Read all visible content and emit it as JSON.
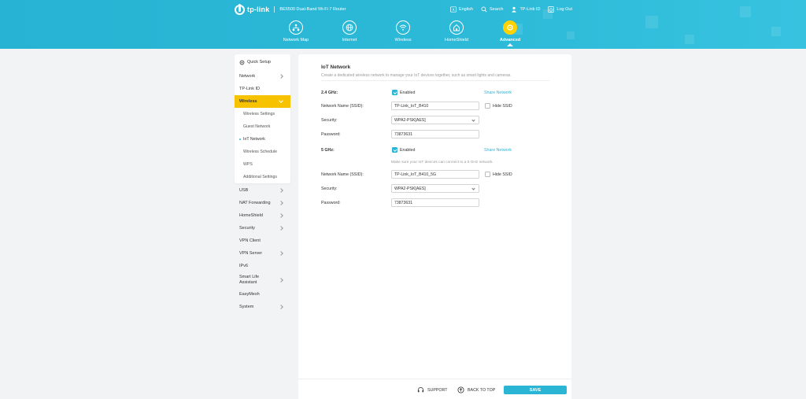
{
  "header": {
    "brand": "tp-link",
    "product": "BE6500 Dual-Band Wi-Fi 7 Router",
    "links": [
      {
        "label": "English",
        "icon": "globe-icon"
      },
      {
        "label": "Search",
        "icon": "search-icon"
      },
      {
        "label": "TP-Link ID",
        "icon": "person-icon"
      },
      {
        "label": "Log Out",
        "icon": "logout-icon"
      }
    ],
    "nav": [
      {
        "label": "Network Map",
        "icon": "network-map-icon"
      },
      {
        "label": "Internet",
        "icon": "globe-icon"
      },
      {
        "label": "Wireless",
        "icon": "wifi-icon"
      },
      {
        "label": "HomeShield",
        "icon": "home-shield-icon"
      },
      {
        "label": "Advanced",
        "icon": "gear-icon",
        "active": true
      }
    ]
  },
  "sidebar": {
    "quick_setup": "Quick Setup",
    "items_top": [
      "Network",
      "TP-Link ID"
    ],
    "active": "Wireless",
    "sub_items": [
      "Wireless Settings",
      "Guest Network",
      "IoT Network",
      "Wireless Schedule",
      "WPS",
      "Additional Settings"
    ],
    "current_sub": "IoT Network",
    "items_bottom": [
      "USB",
      "NAT Forwarding",
      "HomeShield",
      "Security",
      "VPN Client",
      "VPN Server",
      "IPv6",
      "Smart Life Assistant",
      "EasyMesh",
      "System"
    ]
  },
  "main": {
    "title": "IoT Network",
    "description": "Create a dedicated wireless network to manage your IoT devices together, such as smart lights and cameras.",
    "band24": {
      "label": "2.4 GHz:",
      "enabled_label": "Enabled",
      "enabled": true,
      "share": "Share Network",
      "ssid_label": "Network Name (SSID):",
      "ssid": "TP-Link_IoT_B410",
      "hide_ssid": "Hide SSID",
      "security_label": "Security:",
      "security": "WPA2-PSK[AES]",
      "password_label": "Password:",
      "password": "73873631"
    },
    "band5": {
      "label": "5 GHz:",
      "enabled_label": "Enabled",
      "enabled": true,
      "share": "Share Network",
      "hint": "Make sure your IoT devices can connect to a 5 GHz network.",
      "ssid_label": "Network Name (SSID):",
      "ssid": "TP-Link_IoT_B410_5G",
      "hide_ssid": "Hide SSID",
      "security_label": "Security:",
      "security": "WPA2-PSK[AES]",
      "password_label": "Password:",
      "password": "73873631"
    }
  },
  "footer": {
    "support": "SUPPORT",
    "back_to_top": "BACK TO TOP",
    "save": "SAVE"
  },
  "colors": {
    "accent": "#2bb5d5",
    "active": "#f7c200",
    "header": "#2cbad8"
  }
}
